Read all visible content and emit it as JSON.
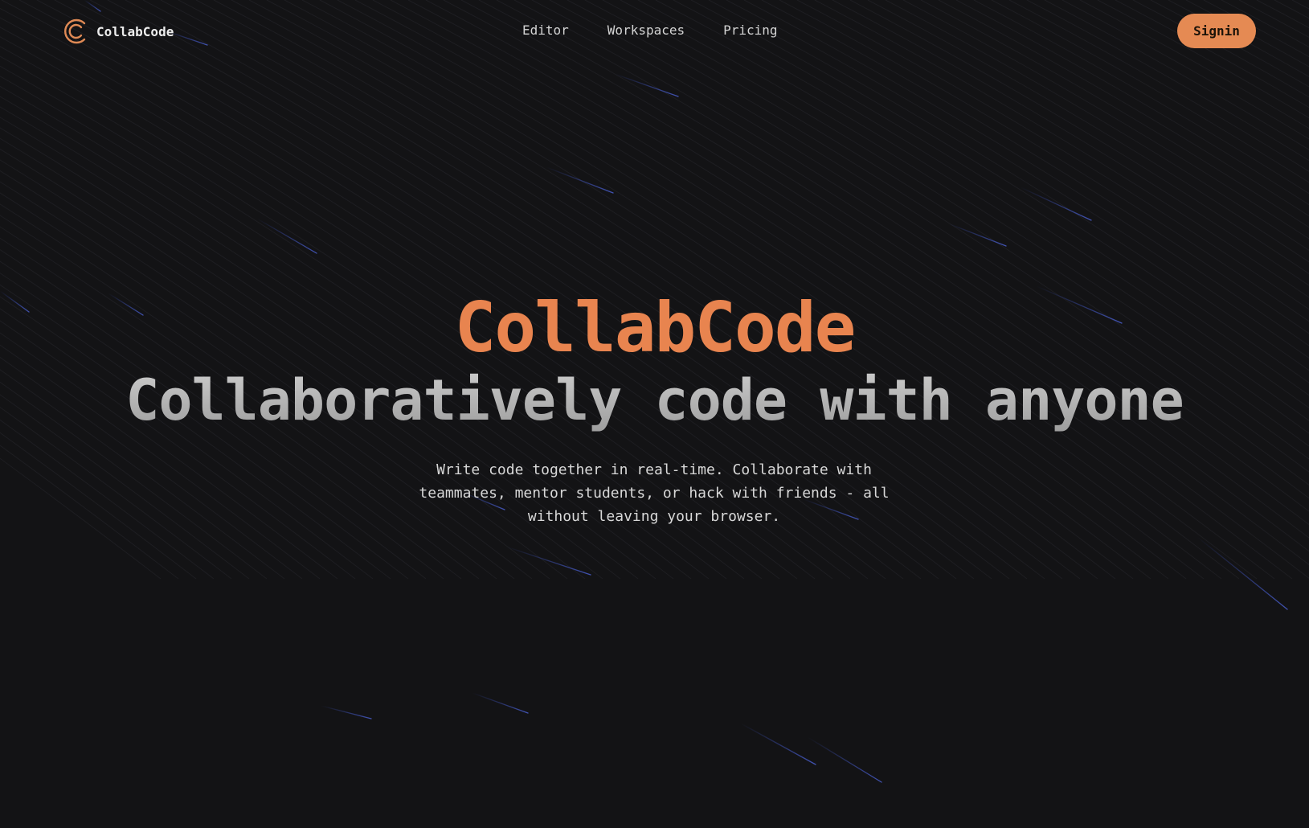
{
  "header": {
    "brand": "CollabCode",
    "nav": [
      {
        "label": "Editor"
      },
      {
        "label": "Workspaces"
      },
      {
        "label": "Pricing"
      }
    ],
    "signin_label": "Signin"
  },
  "hero": {
    "title": "CollabCode",
    "subtitle": "Collaboratively code with anyone",
    "description": "Write code together in real-time. Collaborate with teammates, mentor students, or hack with friends - all without leaving your browser."
  },
  "colors": {
    "background": "#131315",
    "accent": "#e58a53",
    "title": "#e8844f",
    "meteor": "#3a4fb8"
  }
}
